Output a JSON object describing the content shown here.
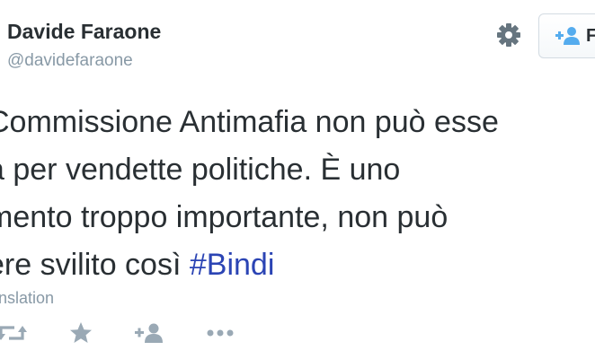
{
  "header": {
    "display_name": "Davide Faraone",
    "handle": "@davidefaraone",
    "follow_label": "F"
  },
  "tweet": {
    "lines": [
      "Commissione Antimafia non può esse",
      "a per vendette politiche. È uno",
      "mento troppo importante, non può",
      "ere svilito così "
    ],
    "hashtag": "#Bindi"
  },
  "translation_label": "anslation",
  "icons": {
    "settings": "gear-icon",
    "follow": "add-user-icon",
    "retweet": "retweet-icon",
    "favorite": "star-icon",
    "follow_action": "add-user-icon",
    "more": "more-dots-icon"
  },
  "colors": {
    "text": "#292f33",
    "muted": "#8899a6",
    "hashtag": "#2b44b4",
    "icon_blue": "#55acee",
    "icon_gray": "#9aa9b5"
  }
}
